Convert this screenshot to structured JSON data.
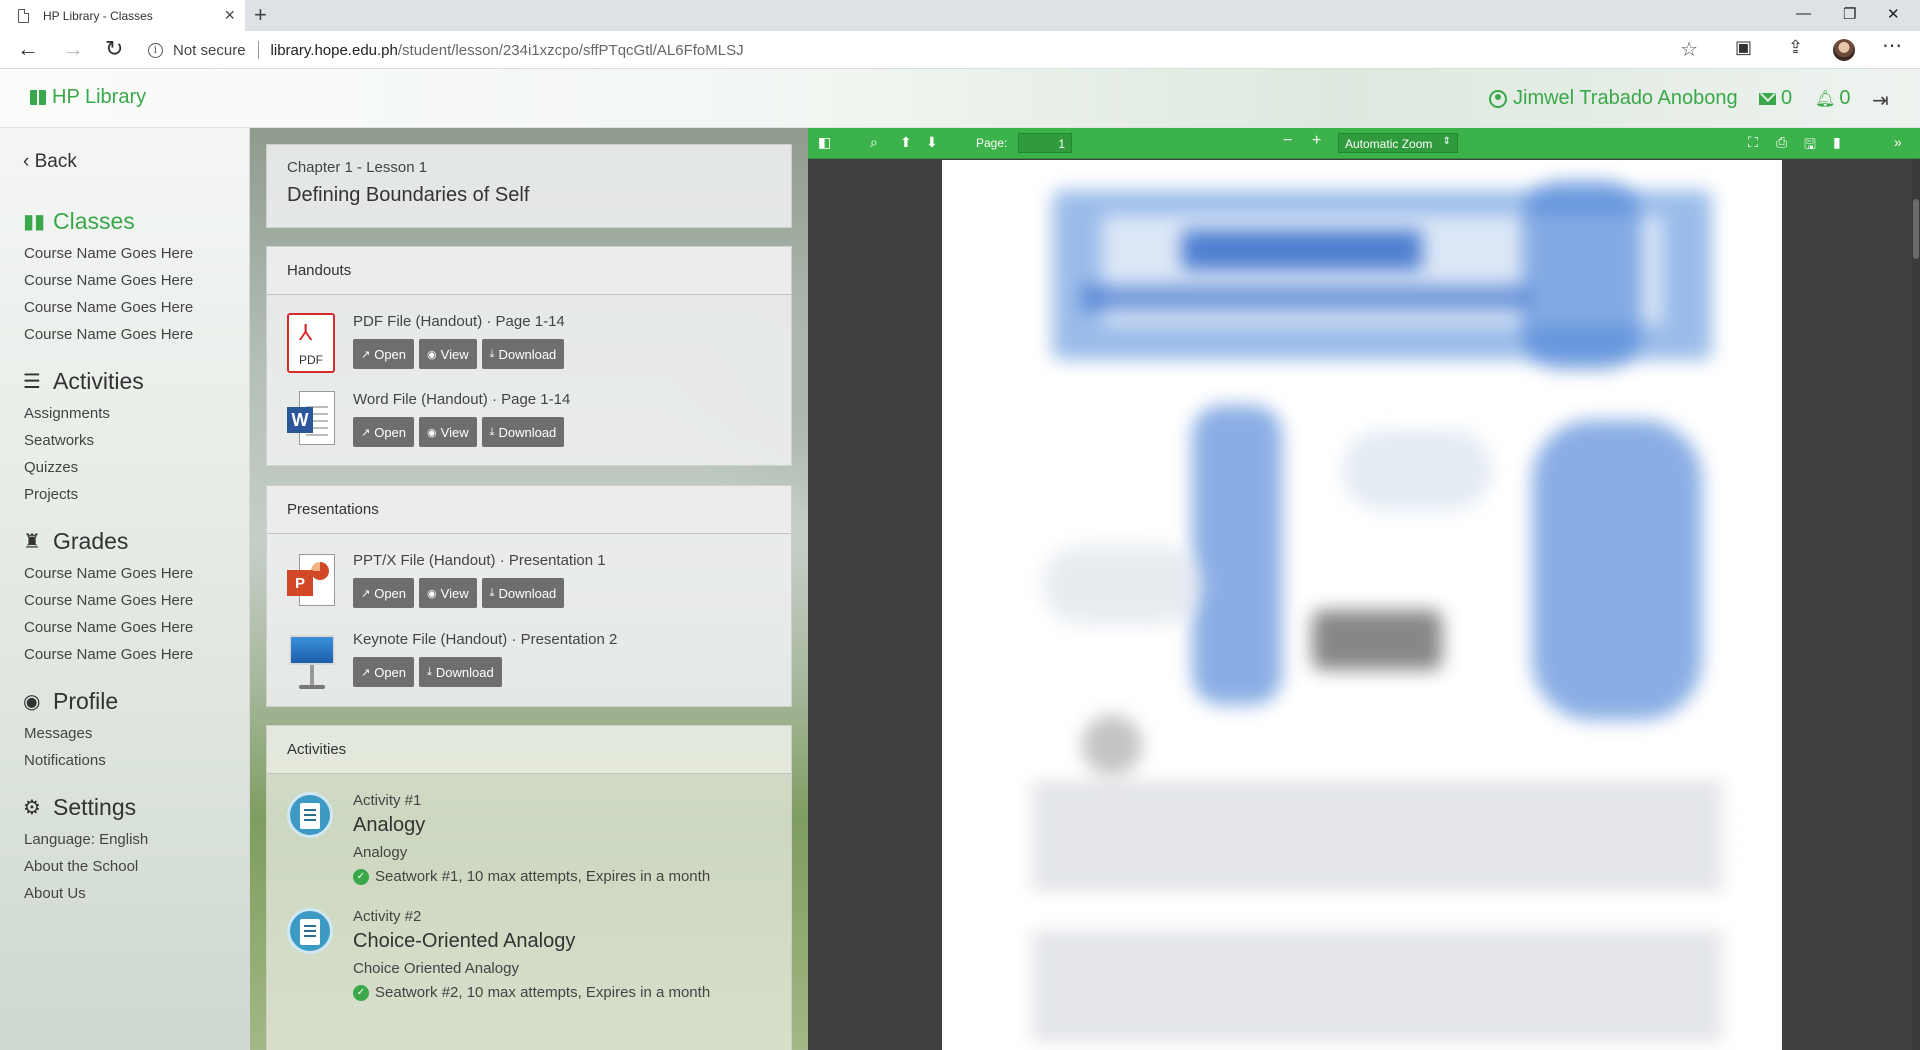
{
  "browser": {
    "tab_title": "HP Library - Classes",
    "not_secure": "Not secure",
    "url_host": "library.hope.edu.ph",
    "url_path": "/student/lesson/234i1xzcpo/sffPTqcGtl/AL6FfoMLSJ"
  },
  "navbar": {
    "brand": "HP Library",
    "user_name": "Jimwel Trabado Anobong",
    "messages_count": "0",
    "notifications_count": "0"
  },
  "sidebar": {
    "back": "Back",
    "classes": {
      "title": "Classes",
      "items": [
        "Course Name Goes Here",
        "Course Name Goes Here",
        "Course Name Goes Here",
        "Course Name Goes Here"
      ]
    },
    "activities": {
      "title": "Activities",
      "items": [
        "Assignments",
        "Seatworks",
        "Quizzes",
        "Projects"
      ]
    },
    "grades": {
      "title": "Grades",
      "items": [
        "Course Name Goes Here",
        "Course Name Goes Here",
        "Course Name Goes Here",
        "Course Name Goes Here"
      ]
    },
    "profile": {
      "title": "Profile",
      "items": [
        "Messages",
        "Notifications"
      ]
    },
    "settings": {
      "title": "Settings",
      "items": [
        "Language: English",
        "About the School",
        "About Us"
      ]
    }
  },
  "lesson": {
    "chapter": "Chapter 1 - Lesson 1",
    "title": "Defining Boundaries of Self"
  },
  "handouts": {
    "heading": "Handouts",
    "files": [
      {
        "title": "PDF File (Handout) · Page 1-14",
        "icon": "pdf-icon",
        "icon_label": "PDF"
      },
      {
        "title": "Word File (Handout) · Page 1-14",
        "icon": "word-icon",
        "icon_label": "W"
      }
    ]
  },
  "presentations": {
    "heading": "Presentations",
    "files": [
      {
        "title": "PPT/X File (Handout) · Presentation 1",
        "icon": "powerpoint-icon",
        "icon_label": "P"
      },
      {
        "title": "Keynote File (Handout) · Presentation 2",
        "icon": "keynote-icon"
      }
    ]
  },
  "buttons": {
    "open": "Open",
    "view": "View",
    "download": "Download"
  },
  "activities": {
    "heading": "Activities",
    "items": [
      {
        "number": "Activity #1",
        "name": "Analogy",
        "subtitle": "Analogy",
        "meta": "Seatwork #1, 10 max attempts, Expires in a month"
      },
      {
        "number": "Activity #2",
        "name": "Choice-Oriented Analogy",
        "subtitle": "Choice Oriented Analogy",
        "meta": "Seatwork #2, 10 max attempts, Expires in a month"
      }
    ]
  },
  "viewer": {
    "page_label": "Page:",
    "page_number": "1",
    "zoom": "Automatic Zoom"
  },
  "colors": {
    "accent": "#3aa84a",
    "button": "#6e6e6e",
    "viewer_bg": "#404040"
  }
}
